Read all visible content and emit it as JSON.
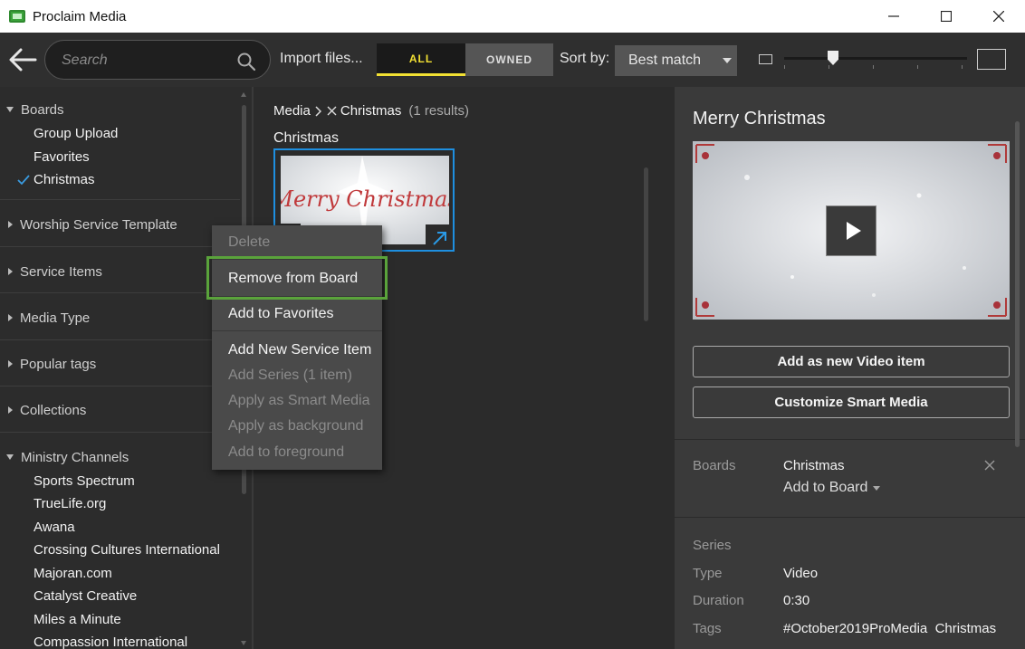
{
  "window": {
    "title": "Proclaim Media",
    "minimize": "—",
    "maximize": "☐",
    "close": "✕"
  },
  "toolbar": {
    "search_placeholder": "Search",
    "import_label": "Import files...",
    "filter_all": "ALL",
    "filter_owned": "OWNED",
    "sort_label": "Sort by:",
    "sort_value": "Best match"
  },
  "sidebar": {
    "boards_header": "Boards",
    "boards": [
      "Group Upload",
      "Favorites",
      "Christmas"
    ],
    "sections": [
      "Worship Service Template",
      "Service Items",
      "Media Type",
      "Popular tags",
      "Collections"
    ],
    "channels_header": "Ministry Channels",
    "channels": [
      "Sports Spectrum",
      "TrueLife.org",
      "Awana",
      "Crossing Cultures International",
      "Majoran.com",
      "Catalyst Creative",
      "Miles a Minute",
      "Compassion International"
    ]
  },
  "main": {
    "crumb_media": "Media",
    "crumb_board": "Christmas",
    "crumb_count": "(1 results)",
    "group_title": "Christmas",
    "thumb_text": "Merry Christmas"
  },
  "context_menu": {
    "delete": "Delete",
    "remove_from_board": "Remove from Board",
    "add_to_favorites": "Add to Favorites",
    "add_new_service_item": "Add New Service Item",
    "add_series": "Add Series (1 item)",
    "apply_smart_media": "Apply as Smart Media",
    "apply_background": "Apply as background",
    "add_foreground": "Add to foreground"
  },
  "details": {
    "title": "Merry Christmas",
    "add_video_btn": "Add as new Video item",
    "customize_btn": "Customize Smart Media",
    "boards_label": "Boards",
    "boards_value": "Christmas",
    "add_to_board": "Add to Board",
    "series_label": "Series",
    "type_label": "Type",
    "type_value": "Video",
    "duration_label": "Duration",
    "duration_value": "0:30",
    "tags_label": "Tags",
    "tags_value": "#October2019ProMedia  Christmas"
  },
  "colors": {
    "accent_yellow": "#f2e033",
    "selection_blue": "#1e8fe0",
    "highlight_green": "#5aa33b"
  }
}
